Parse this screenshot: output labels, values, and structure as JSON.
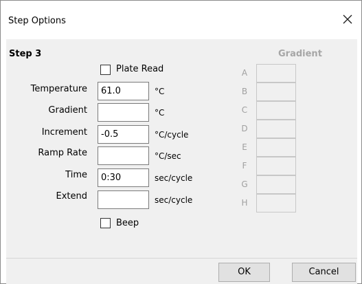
{
  "window": {
    "title": "Step Options",
    "close_icon": "close-icon"
  },
  "step": {
    "title": "Step 3",
    "plate_read_label": "Plate Read",
    "beep_label": "Beep",
    "plate_read_checked": false,
    "beep_checked": false
  },
  "fields": {
    "temperature": {
      "label": "Temperature",
      "value": "61.0",
      "unit": "°C"
    },
    "gradient": {
      "label": "Gradient",
      "value": "",
      "unit": "°C"
    },
    "increment": {
      "label": "Increment",
      "value": "-0.5",
      "unit": "°C/cycle"
    },
    "ramp_rate": {
      "label": "Ramp Rate",
      "value": "",
      "unit": "°C/sec"
    },
    "time": {
      "label": "Time",
      "value": "0:30",
      "unit": "sec/cycle"
    },
    "extend": {
      "label": "Extend",
      "value": "",
      "unit": "sec/cycle"
    }
  },
  "gradient_panel": {
    "title": "Gradient",
    "rows": [
      "A",
      "B",
      "C",
      "D",
      "E",
      "F",
      "G",
      "H"
    ]
  },
  "buttons": {
    "ok": "OK",
    "cancel": "Cancel"
  }
}
